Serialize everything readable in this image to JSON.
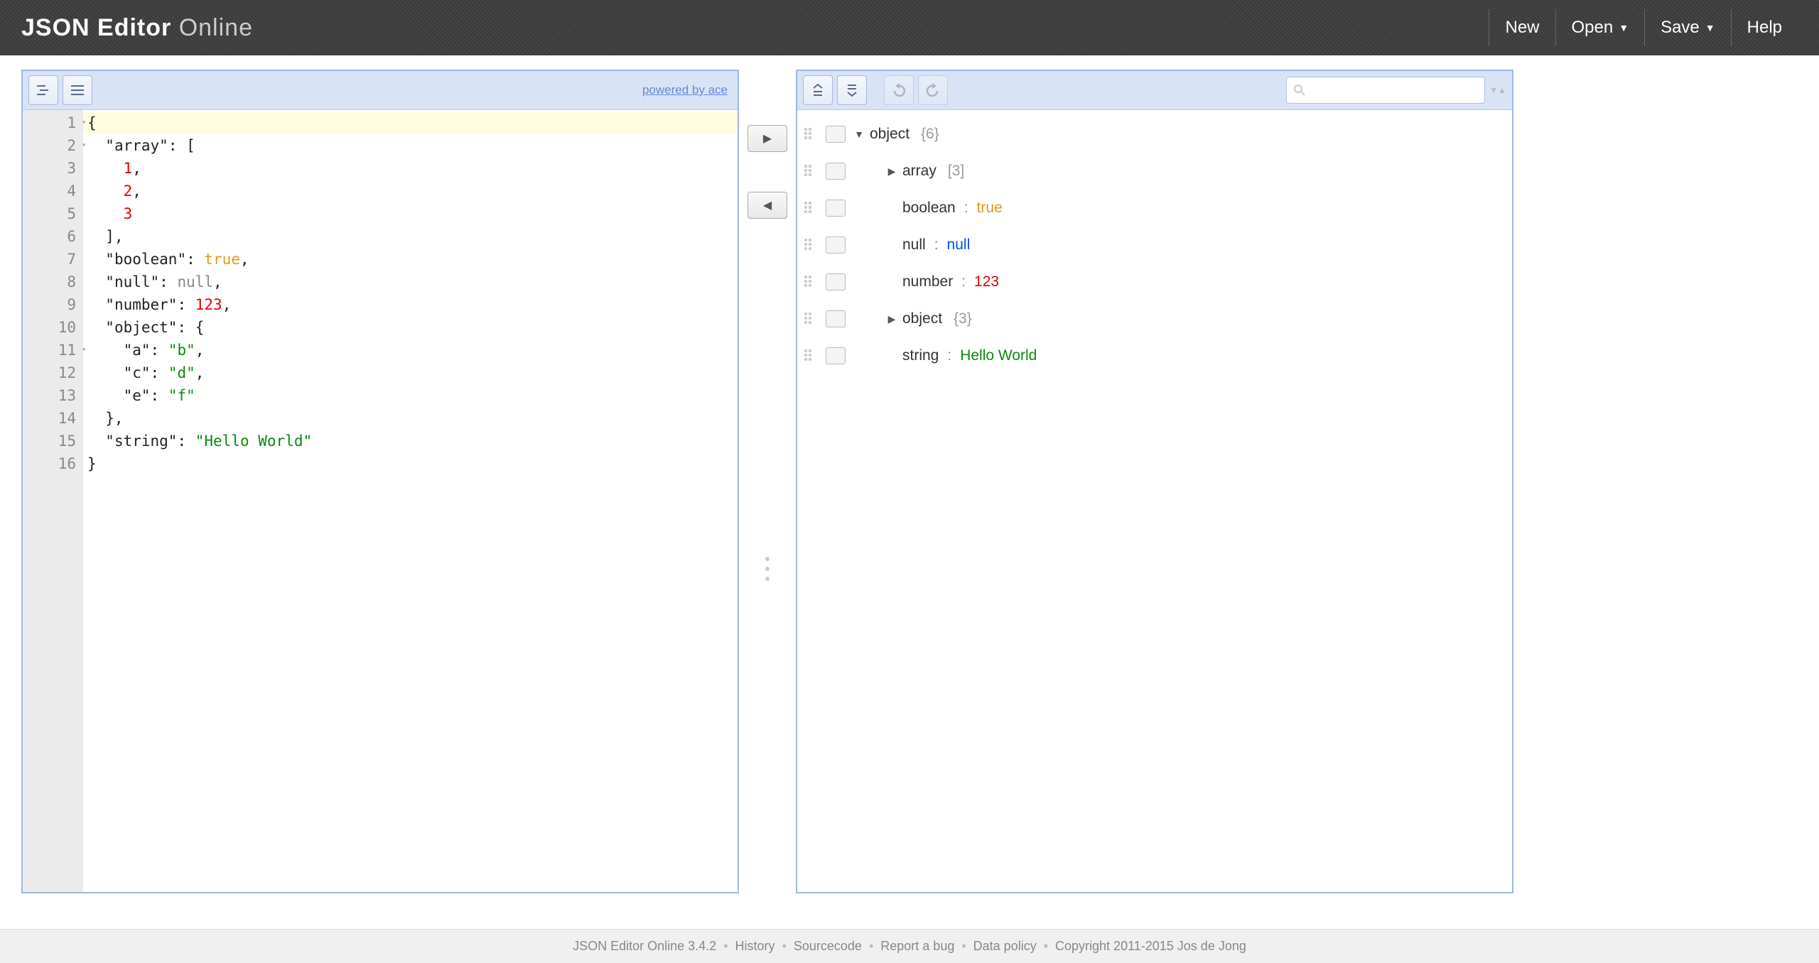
{
  "header": {
    "logo_bold": "JSON Editor",
    "logo_thin": "Online",
    "nav": {
      "new": "New",
      "open": "Open",
      "save": "Save",
      "help": "Help"
    }
  },
  "left_pane": {
    "powered_by": "powered by ace",
    "lines": [
      {
        "num": "1",
        "fold": true,
        "tokens": [
          {
            "t": "punct",
            "v": "{"
          }
        ]
      },
      {
        "num": "2",
        "fold": true,
        "tokens": [
          {
            "t": "punct",
            "v": "  "
          },
          {
            "t": "key",
            "v": "\"array\""
          },
          {
            "t": "punct",
            "v": ": ["
          }
        ]
      },
      {
        "num": "3",
        "tokens": [
          {
            "t": "punct",
            "v": "    "
          },
          {
            "t": "num",
            "v": "1"
          },
          {
            "t": "punct",
            "v": ","
          }
        ]
      },
      {
        "num": "4",
        "tokens": [
          {
            "t": "punct",
            "v": "    "
          },
          {
            "t": "num",
            "v": "2"
          },
          {
            "t": "punct",
            "v": ","
          }
        ]
      },
      {
        "num": "5",
        "tokens": [
          {
            "t": "punct",
            "v": "    "
          },
          {
            "t": "num",
            "v": "3"
          }
        ]
      },
      {
        "num": "6",
        "tokens": [
          {
            "t": "punct",
            "v": "  ],"
          }
        ]
      },
      {
        "num": "7",
        "tokens": [
          {
            "t": "punct",
            "v": "  "
          },
          {
            "t": "key",
            "v": "\"boolean\""
          },
          {
            "t": "punct",
            "v": ": "
          },
          {
            "t": "bool",
            "v": "true"
          },
          {
            "t": "punct",
            "v": ","
          }
        ]
      },
      {
        "num": "8",
        "tokens": [
          {
            "t": "punct",
            "v": "  "
          },
          {
            "t": "key",
            "v": "\"null\""
          },
          {
            "t": "punct",
            "v": ": "
          },
          {
            "t": "nullv",
            "v": "null"
          },
          {
            "t": "punct",
            "v": ","
          }
        ]
      },
      {
        "num": "9",
        "tokens": [
          {
            "t": "punct",
            "v": "  "
          },
          {
            "t": "key",
            "v": "\"number\""
          },
          {
            "t": "punct",
            "v": ": "
          },
          {
            "t": "num",
            "v": "123"
          },
          {
            "t": "punct",
            "v": ","
          }
        ]
      },
      {
        "num": "10",
        "tokens": [
          {
            "t": "punct",
            "v": "  "
          },
          {
            "t": "key",
            "v": "\"object\""
          },
          {
            "t": "punct",
            "v": ": {"
          }
        ]
      },
      {
        "num": "11",
        "fold": true,
        "tokens": [
          {
            "t": "punct",
            "v": "    "
          },
          {
            "t": "key",
            "v": "\"a\""
          },
          {
            "t": "punct",
            "v": ": "
          },
          {
            "t": "str",
            "v": "\"b\""
          },
          {
            "t": "punct",
            "v": ","
          }
        ]
      },
      {
        "num": "12",
        "tokens": [
          {
            "t": "punct",
            "v": "    "
          },
          {
            "t": "key",
            "v": "\"c\""
          },
          {
            "t": "punct",
            "v": ": "
          },
          {
            "t": "str",
            "v": "\"d\""
          },
          {
            "t": "punct",
            "v": ","
          }
        ]
      },
      {
        "num": "13",
        "tokens": [
          {
            "t": "punct",
            "v": "    "
          },
          {
            "t": "key",
            "v": "\"e\""
          },
          {
            "t": "punct",
            "v": ": "
          },
          {
            "t": "str",
            "v": "\"f\""
          }
        ]
      },
      {
        "num": "14",
        "tokens": [
          {
            "t": "punct",
            "v": "  },"
          }
        ]
      },
      {
        "num": "15",
        "tokens": [
          {
            "t": "punct",
            "v": "  "
          },
          {
            "t": "key",
            "v": "\"string\""
          },
          {
            "t": "punct",
            "v": ": "
          },
          {
            "t": "str",
            "v": "\"Hello World\""
          }
        ]
      },
      {
        "num": "16",
        "tokens": [
          {
            "t": "punct",
            "v": "}"
          }
        ]
      }
    ]
  },
  "tree": {
    "rows": [
      {
        "expand": "▼",
        "key": "object",
        "count": "{6}"
      },
      {
        "indent": 1,
        "expand": "▶",
        "key": "array",
        "count": "[3]"
      },
      {
        "indent": 1,
        "key": "boolean",
        "sep": ":",
        "val": "true",
        "vclass": "tree-true"
      },
      {
        "indent": 1,
        "key": "null",
        "sep": ":",
        "val": "null",
        "vclass": "tree-null"
      },
      {
        "indent": 1,
        "key": "number",
        "sep": ":",
        "val": "123",
        "vclass": "tree-num"
      },
      {
        "indent": 1,
        "expand": "▶",
        "key": "object",
        "count": "{3}"
      },
      {
        "indent": 1,
        "key": "string",
        "sep": ":",
        "val": "Hello World",
        "vclass": "tree-str"
      }
    ]
  },
  "footer": {
    "version": "JSON Editor Online 3.4.2",
    "links": [
      "History",
      "Sourcecode",
      "Report a bug",
      "Data policy"
    ],
    "copyright": "Copyright 2011-2015 Jos de Jong"
  }
}
